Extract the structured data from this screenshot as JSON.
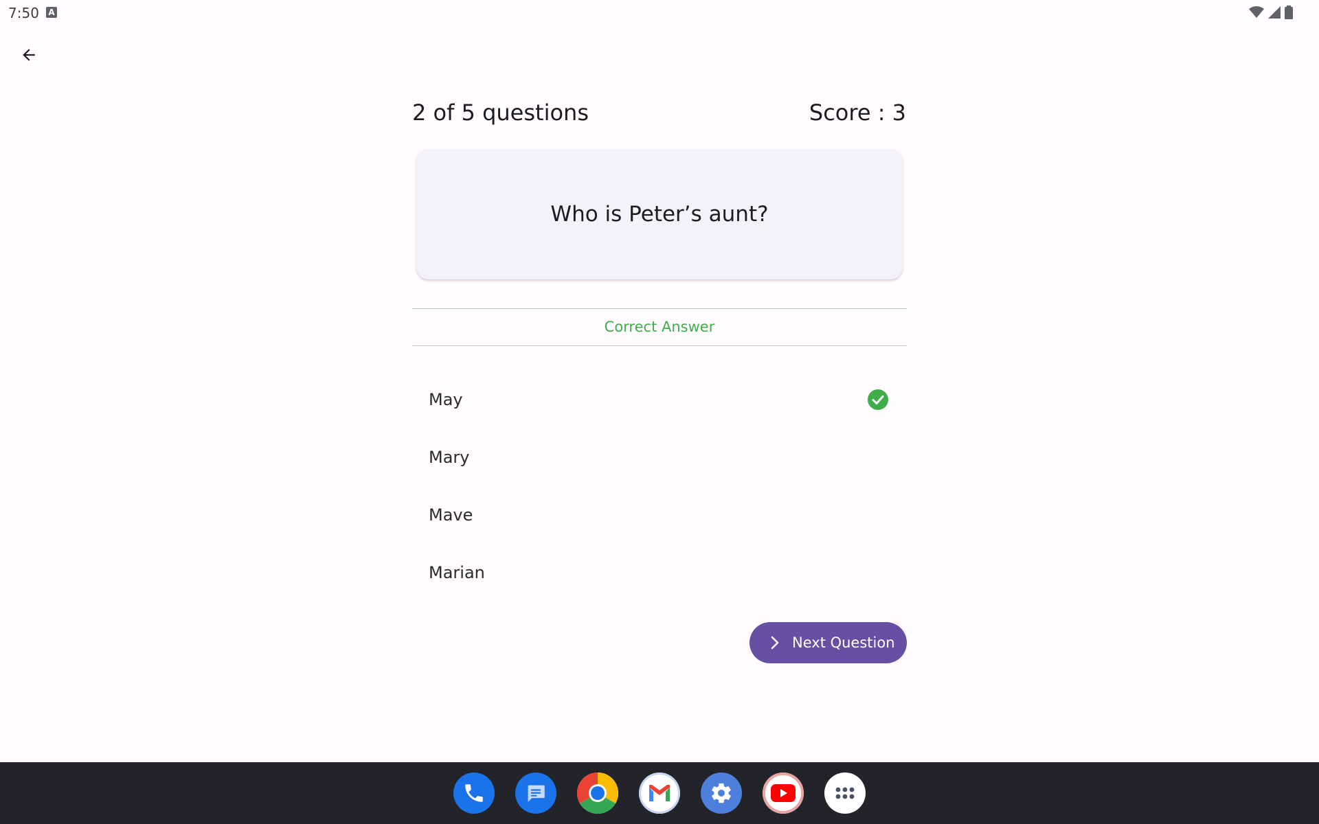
{
  "status_bar": {
    "time": "7:50",
    "keyboard_indicator": "A"
  },
  "header": {
    "back_icon": "arrow-back-icon"
  },
  "quiz": {
    "progress_text": "2 of 5 questions",
    "score_text": "Score : 3",
    "question": "Who is Peter’s aunt?",
    "feedback": "Correct Answer",
    "feedback_color": "#3fae49",
    "options": [
      {
        "label": "May",
        "correct": true
      },
      {
        "label": "Mary",
        "correct": false
      },
      {
        "label": "Mave",
        "correct": false
      },
      {
        "label": "Marian",
        "correct": false
      }
    ],
    "next_button_label": "Next Question",
    "accent_color": "#6750a4"
  },
  "dock": {
    "apps": [
      "phone-icon",
      "messages-icon",
      "chrome-icon",
      "gmail-icon",
      "settings-icon",
      "youtube-icon",
      "app-drawer-icon"
    ]
  }
}
